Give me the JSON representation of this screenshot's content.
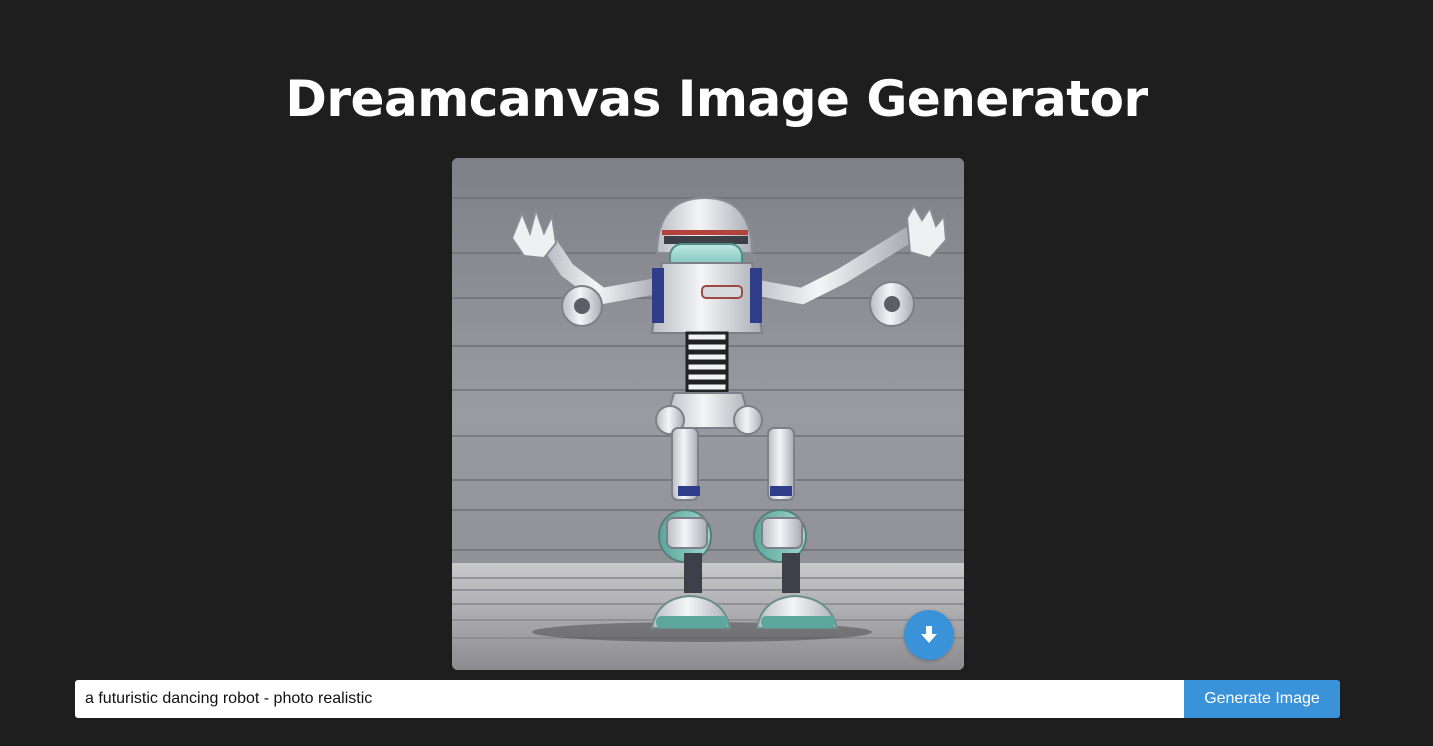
{
  "header": {
    "title": "Dreamcanvas Image Generator"
  },
  "generated_image": {
    "description_icon": "generated-robot-image",
    "download_icon": "download-arrow-icon"
  },
  "prompt": {
    "value": "a futuristic dancing robot - photo realistic",
    "placeholder": ""
  },
  "actions": {
    "generate_label": "Generate Image"
  },
  "colors": {
    "background": "#1e1e1e",
    "accent": "#3a92d8",
    "title_text": "#ffffff"
  }
}
